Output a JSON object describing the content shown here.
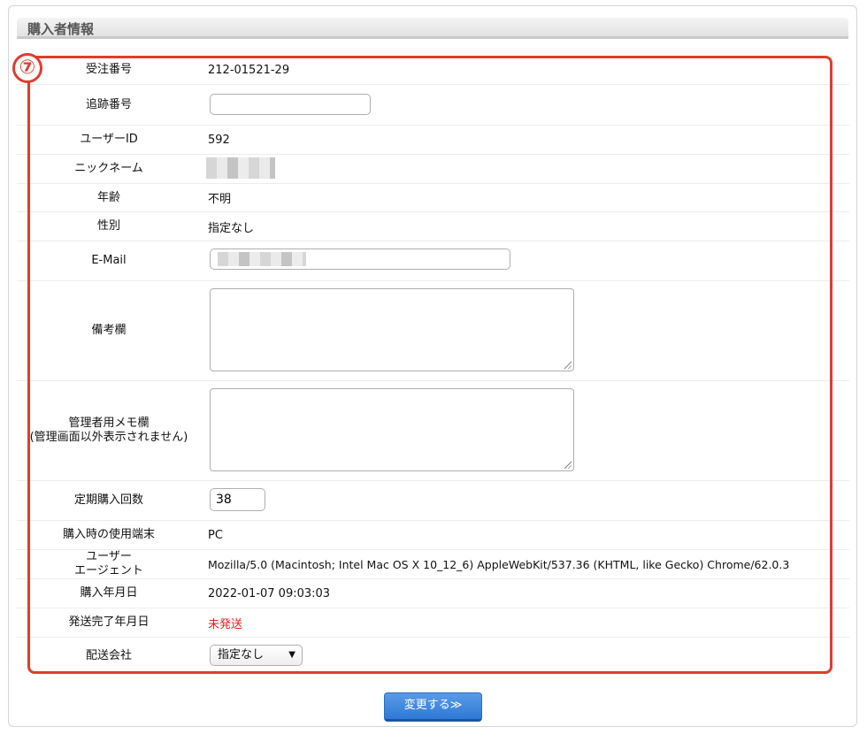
{
  "section": {
    "title": "購入者情報",
    "annotation_number": "⑦"
  },
  "rows": {
    "order_no": {
      "label": "受注番号",
      "value": "212-01521-29"
    },
    "tracking_no": {
      "label": "追跡番号",
      "value": ""
    },
    "user_id": {
      "label": "ユーザーID",
      "value": "592"
    },
    "nickname": {
      "label": "ニックネーム"
    },
    "age": {
      "label": "年齢",
      "value": "不明"
    },
    "gender": {
      "label": "性別",
      "value": "指定なし"
    },
    "email": {
      "label": "E-Mail"
    },
    "remarks": {
      "label": "備考欄"
    },
    "admin_memo": {
      "label": "管理者用メモ欄\n(管理画面以外表示されません)"
    },
    "subscription_count": {
      "label": "定期購入回数",
      "value": "38"
    },
    "device": {
      "label": "購入時の使用端末",
      "value": "PC"
    },
    "user_agent": {
      "label": "ユーザー\nエージェント",
      "value": "Mozilla/5.0 (Macintosh; Intel Mac OS X 10_12_6) AppleWebKit/537.36 (KHTML, like Gecko) Chrome/62.0.3"
    },
    "purchase_date": {
      "label": "購入年月日",
      "value": "2022-01-07 09:03:03"
    },
    "shipped_date": {
      "label": "発送完了年月日",
      "value": "未発送"
    },
    "carrier": {
      "label": "配送会社",
      "value": "指定なし"
    }
  },
  "submit_label": "変更する≫",
  "colors": {
    "annotation": "#e03c2e",
    "button": "#3a86dd",
    "unshipped": "#e5201e"
  }
}
